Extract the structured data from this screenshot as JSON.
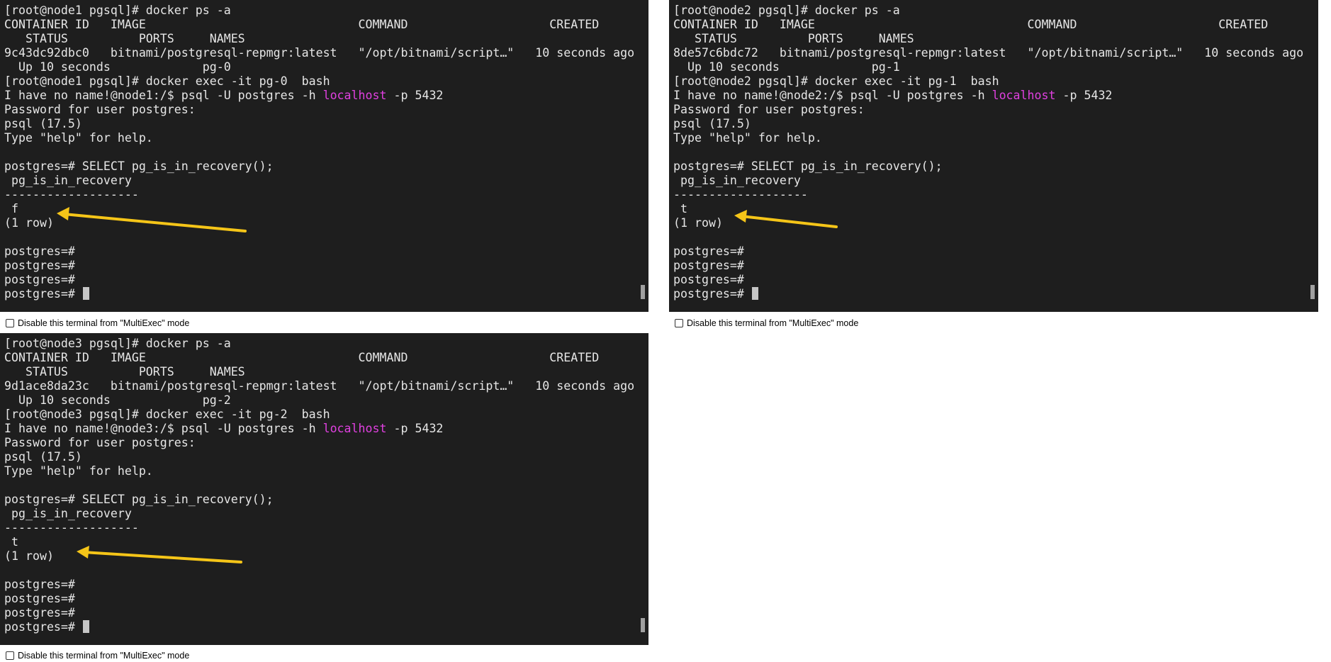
{
  "colors": {
    "terminal_bg": "#1e1e1e",
    "terminal_fg": "#e6e6e6",
    "highlight": "#e040e0",
    "arrow": "#f5c518",
    "page_bg": "#ffffff"
  },
  "multiexec_label": "Disable this terminal from \"MultiExec\" mode",
  "terminals": [
    {
      "id": "node1",
      "lines": [
        "[root@node1 pgsql]# docker ps -a",
        "CONTAINER ID   IMAGE                              COMMAND                    CREATED",
        "   STATUS          PORTS     NAMES",
        "9c43dc92dbc0   bitnami/postgresql-repmgr:latest   \"/opt/bitnami/script…\"   10 seconds ago",
        "  Up 10 seconds             pg-0",
        "[root@node1 pgsql]# docker exec -it pg-0  bash",
        "I have no name!@node1:/$ psql -U postgres -h ",
        "Password for user postgres:",
        "psql (17.5)",
        "Type \"help\" for help.",
        "",
        "postgres=# SELECT pg_is_in_recovery();",
        " pg_is_in_recovery",
        "-------------------",
        " f",
        "(1 row)",
        "",
        "postgres=#",
        "postgres=#",
        "postgres=#",
        "postgres=# "
      ],
      "psql_host": "localhost",
      "psql_port_suffix": " -p 5432"
    },
    {
      "id": "node2",
      "lines": [
        "[root@node2 pgsql]# docker ps -a",
        "CONTAINER ID   IMAGE                              COMMAND                    CREATED",
        "   STATUS          PORTS     NAMES",
        "8de57c6bdc72   bitnami/postgresql-repmgr:latest   \"/opt/bitnami/script…\"   10 seconds ago",
        "  Up 10 seconds             pg-1",
        "[root@node2 pgsql]# docker exec -it pg-1  bash",
        "I have no name!@node2:/$ psql -U postgres -h ",
        "Password for user postgres:",
        "psql (17.5)",
        "Type \"help\" for help.",
        "",
        "postgres=# SELECT pg_is_in_recovery();",
        " pg_is_in_recovery",
        "-------------------",
        " t",
        "(1 row)",
        "",
        "postgres=#",
        "postgres=#",
        "postgres=#",
        "postgres=# "
      ],
      "psql_host": "localhost",
      "psql_port_suffix": " -p 5432"
    },
    {
      "id": "node3",
      "lines": [
        "[root@node3 pgsql]# docker ps -a",
        "CONTAINER ID   IMAGE                              COMMAND                    CREATED",
        "   STATUS          PORTS     NAMES",
        "9d1ace8da23c   bitnami/postgresql-repmgr:latest   \"/opt/bitnami/script…\"   10 seconds ago",
        "  Up 10 seconds             pg-2",
        "[root@node3 pgsql]# docker exec -it pg-2  bash",
        "I have no name!@node3:/$ psql -U postgres -h ",
        "Password for user postgres:",
        "psql (17.5)",
        "Type \"help\" for help.",
        "",
        "postgres=# SELECT pg_is_in_recovery();",
        " pg_is_in_recovery",
        "-------------------",
        " t",
        "(1 row)",
        "",
        "postgres=#",
        "postgres=#",
        "postgres=#",
        "postgres=# "
      ],
      "psql_host": "localhost",
      "psql_port_suffix": " -p 5432"
    }
  ]
}
